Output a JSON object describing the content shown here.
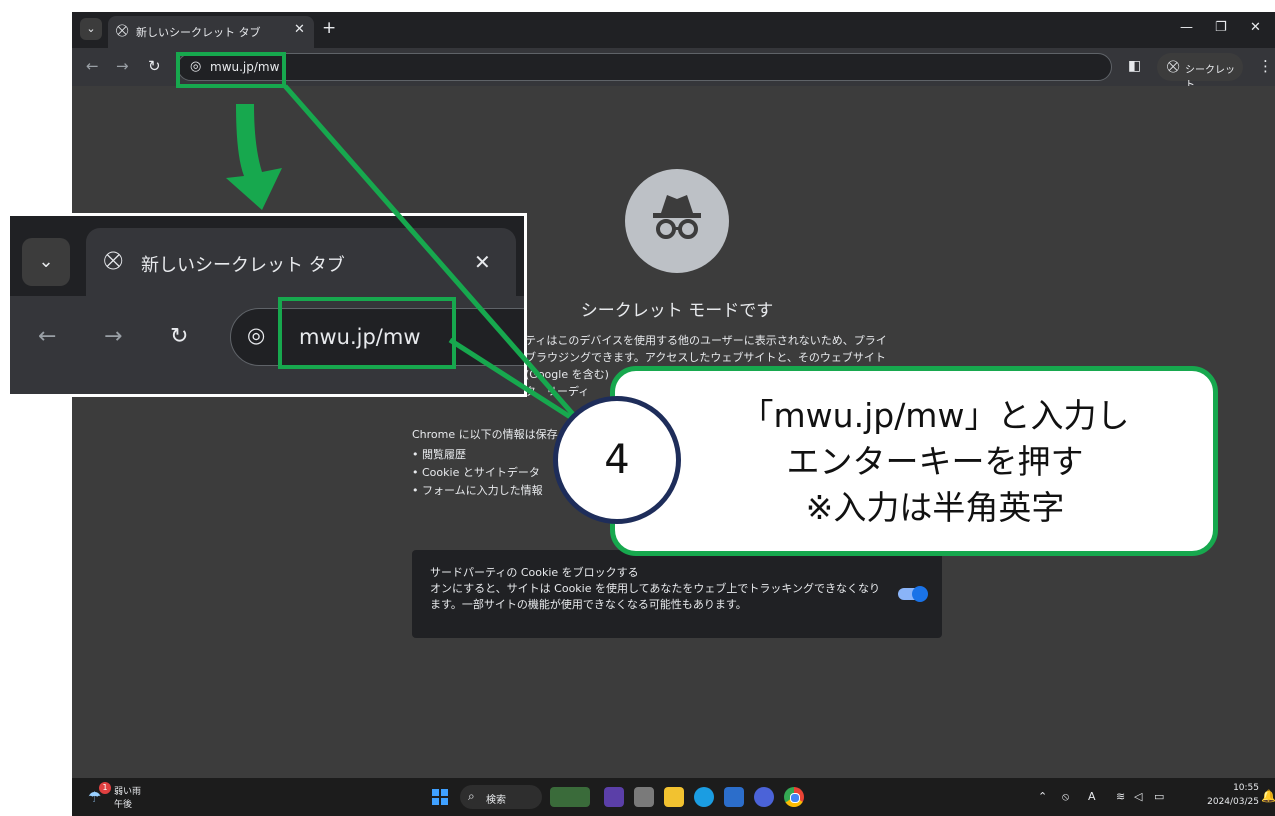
{
  "browser": {
    "tab_title": "新しいシークレット タブ",
    "url": "mwu.jp/mw",
    "incognito_chip_label": "シークレット"
  },
  "incognito_page": {
    "title": "シークレット モードです",
    "description_lines": [
      "ティはこのデバイスを使用する他のユーザーに表示されないため、プライ",
      "ブラウジングできます。アクセスしたウェブサイトと、そのウェブサイト",
      "(Google を含む)",
      "ク、リーディ"
    ],
    "saved_heading": "Chrome に以下の情報は保存",
    "saved_items": [
      "閲覧履歴",
      "Cookie とサイトデータ",
      "フォームに入力した情報"
    ],
    "cookie_title": "サードパーティの Cookie をブロックする",
    "cookie_desc": "オンにすると、サイトは Cookie を使用してあなたをウェブ上でトラッキングできなくなります。一部サイトの機能が使用できなくなる可能性もあります。",
    "cookie_toggle_on": true
  },
  "taskbar": {
    "weather_label": "弱い雨",
    "weather_sub": "午後",
    "weather_badge": "1",
    "search_label": "検索",
    "time": "10:55",
    "date": "2024/03/25"
  },
  "annotation": {
    "step_number": "4",
    "line1": "「mwu.jp/mw」と入力し",
    "line2": "エンターキーを押す",
    "line3": "※入力は半角英字",
    "highlight_color": "#17a84e",
    "circle_border_color": "#1e2d5a"
  },
  "icons": {
    "tab": "incognito-icon",
    "omnibox": "globe-icon",
    "arrow": "down-arrow-icon"
  }
}
